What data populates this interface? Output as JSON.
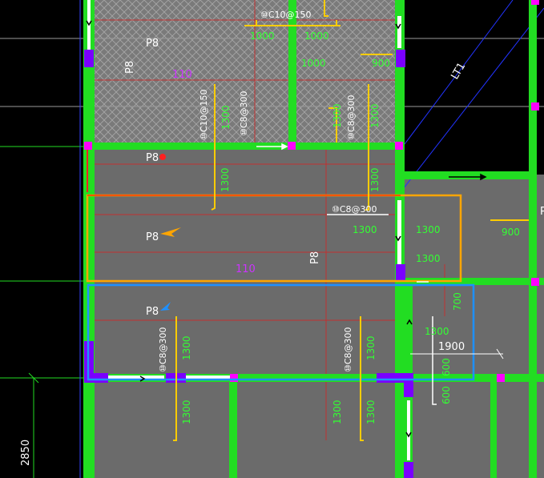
{
  "colors": {
    "background": "#000000",
    "slab": "#6b6b6b",
    "beam": "#22dd22",
    "column": "#7a00ff",
    "node": "#ff00ff",
    "rebar": "#ffcc00",
    "text_white": "#ffffff",
    "text_green": "#33ff33",
    "highlight_orange": "#ffa500",
    "highlight_blue": "#1e90ff",
    "grid_line": "#aaaaaa",
    "red_line": "#cc3333"
  },
  "labels": {
    "slab_p8_1": "P8",
    "slab_p8_2": "P8",
    "slab_p8_3": "P8",
    "slab_p8_4": "P8",
    "slab_p8_5": "P8",
    "slab_p8_right": "P",
    "beam_lt1": "LT1",
    "purple_110_top": "110",
    "purple_110_mid": "110",
    "dim_2850": "2850"
  },
  "rebar_labels": {
    "top_c10": "⑩C10@150",
    "c10_vertical": "⑩C10@150",
    "c8_vertical_1": "⑩C8@300",
    "c8_vertical_2": "⑩C8@300",
    "c8_horizontal": "⑩C8@300",
    "c8_bottom_1": "⑩C8@300",
    "c8_bottom_2": "⑩C8@300"
  },
  "dims": {
    "d1000_a": "1000",
    "d1000_b": "1000",
    "d1000_c": "1000",
    "d900_a": "900",
    "d900_b": "900",
    "d1300_v1": "1300",
    "d1300_v2": "1300",
    "d1300_v3": "1300",
    "d1300_v4": "1300",
    "d1300_h1": "1300",
    "d1300_h2": "1300",
    "d1300_h3": "1300",
    "d1300_h4": "1300",
    "d1300_b1": "1300",
    "d1300_b2": "1300",
    "d1300_b3": "1300",
    "d1300_b4": "1300",
    "d1300_b5": "1300",
    "d700": "700",
    "d1900": "1900",
    "d600_a": "600",
    "d600_b": "600"
  }
}
